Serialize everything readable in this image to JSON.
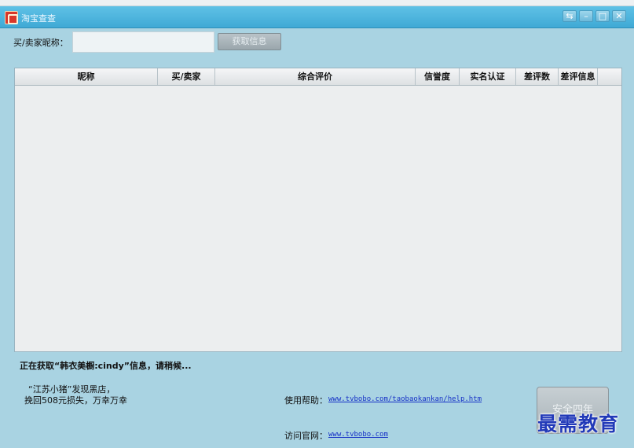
{
  "window": {
    "title": "淘宝查查",
    "controls": [
      "⇆",
      "–",
      "□",
      "✕"
    ]
  },
  "search": {
    "label": "买/卖家昵称：",
    "value": "",
    "placeholder": "",
    "button_label": "获取信息"
  },
  "table": {
    "columns": [
      {
        "label": "昵称"
      },
      {
        "label": "买/卖家"
      },
      {
        "label": "综合评价"
      },
      {
        "label": "信誉度"
      },
      {
        "label": "实名认证"
      },
      {
        "label": "差评数"
      },
      {
        "label": "差评信息"
      }
    ],
    "rows": []
  },
  "status_text": "正在获取“韩衣美橱:cindy”信息，请稍候...",
  "promo": {
    "line1": "“江苏小猪”发现黑店，",
    "line2": "挽回508元损失，万幸万幸"
  },
  "help": {
    "label": "使用帮助：",
    "url": "www.tvbobo.com/taobaokankan/help.htm"
  },
  "site": {
    "label": "访问官网：",
    "url": "www.tvbobo.com"
  },
  "safe_button_label": "安全四年",
  "watermark": "最需教育",
  "colors": {
    "background": "#a9d3e2",
    "titlebar": "#4fb6df",
    "link": "#1530c6"
  }
}
